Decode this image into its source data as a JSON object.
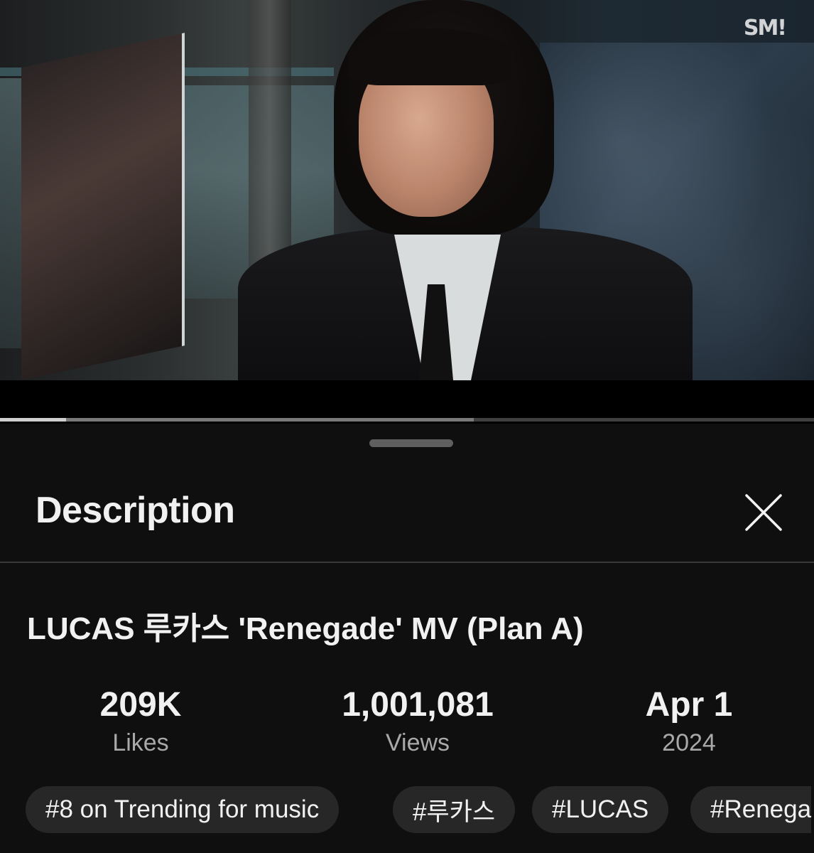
{
  "video": {
    "watermark": "SM!",
    "progress": {
      "played_fraction": 0.081,
      "buffered_fraction": 0.582
    }
  },
  "sheet": {
    "title": "Description",
    "close_icon": "close-icon"
  },
  "description": {
    "video_title": "LUCAS 루카스 'Renegade' MV (Plan A)",
    "stats": [
      {
        "value": "209K",
        "label": "Likes"
      },
      {
        "value": "1,001,081",
        "label": "Views"
      },
      {
        "value": "Apr 1",
        "label": "2024"
      }
    ],
    "chips": [
      "#8 on Trending for music",
      "#루카스",
      "#LUCAS",
      "#Renega"
    ]
  },
  "colors": {
    "sheet_bg": "#0f0f0f",
    "chip_bg": "#272727",
    "text_primary": "#f1f1f1",
    "text_secondary": "#a9a9a9"
  }
}
